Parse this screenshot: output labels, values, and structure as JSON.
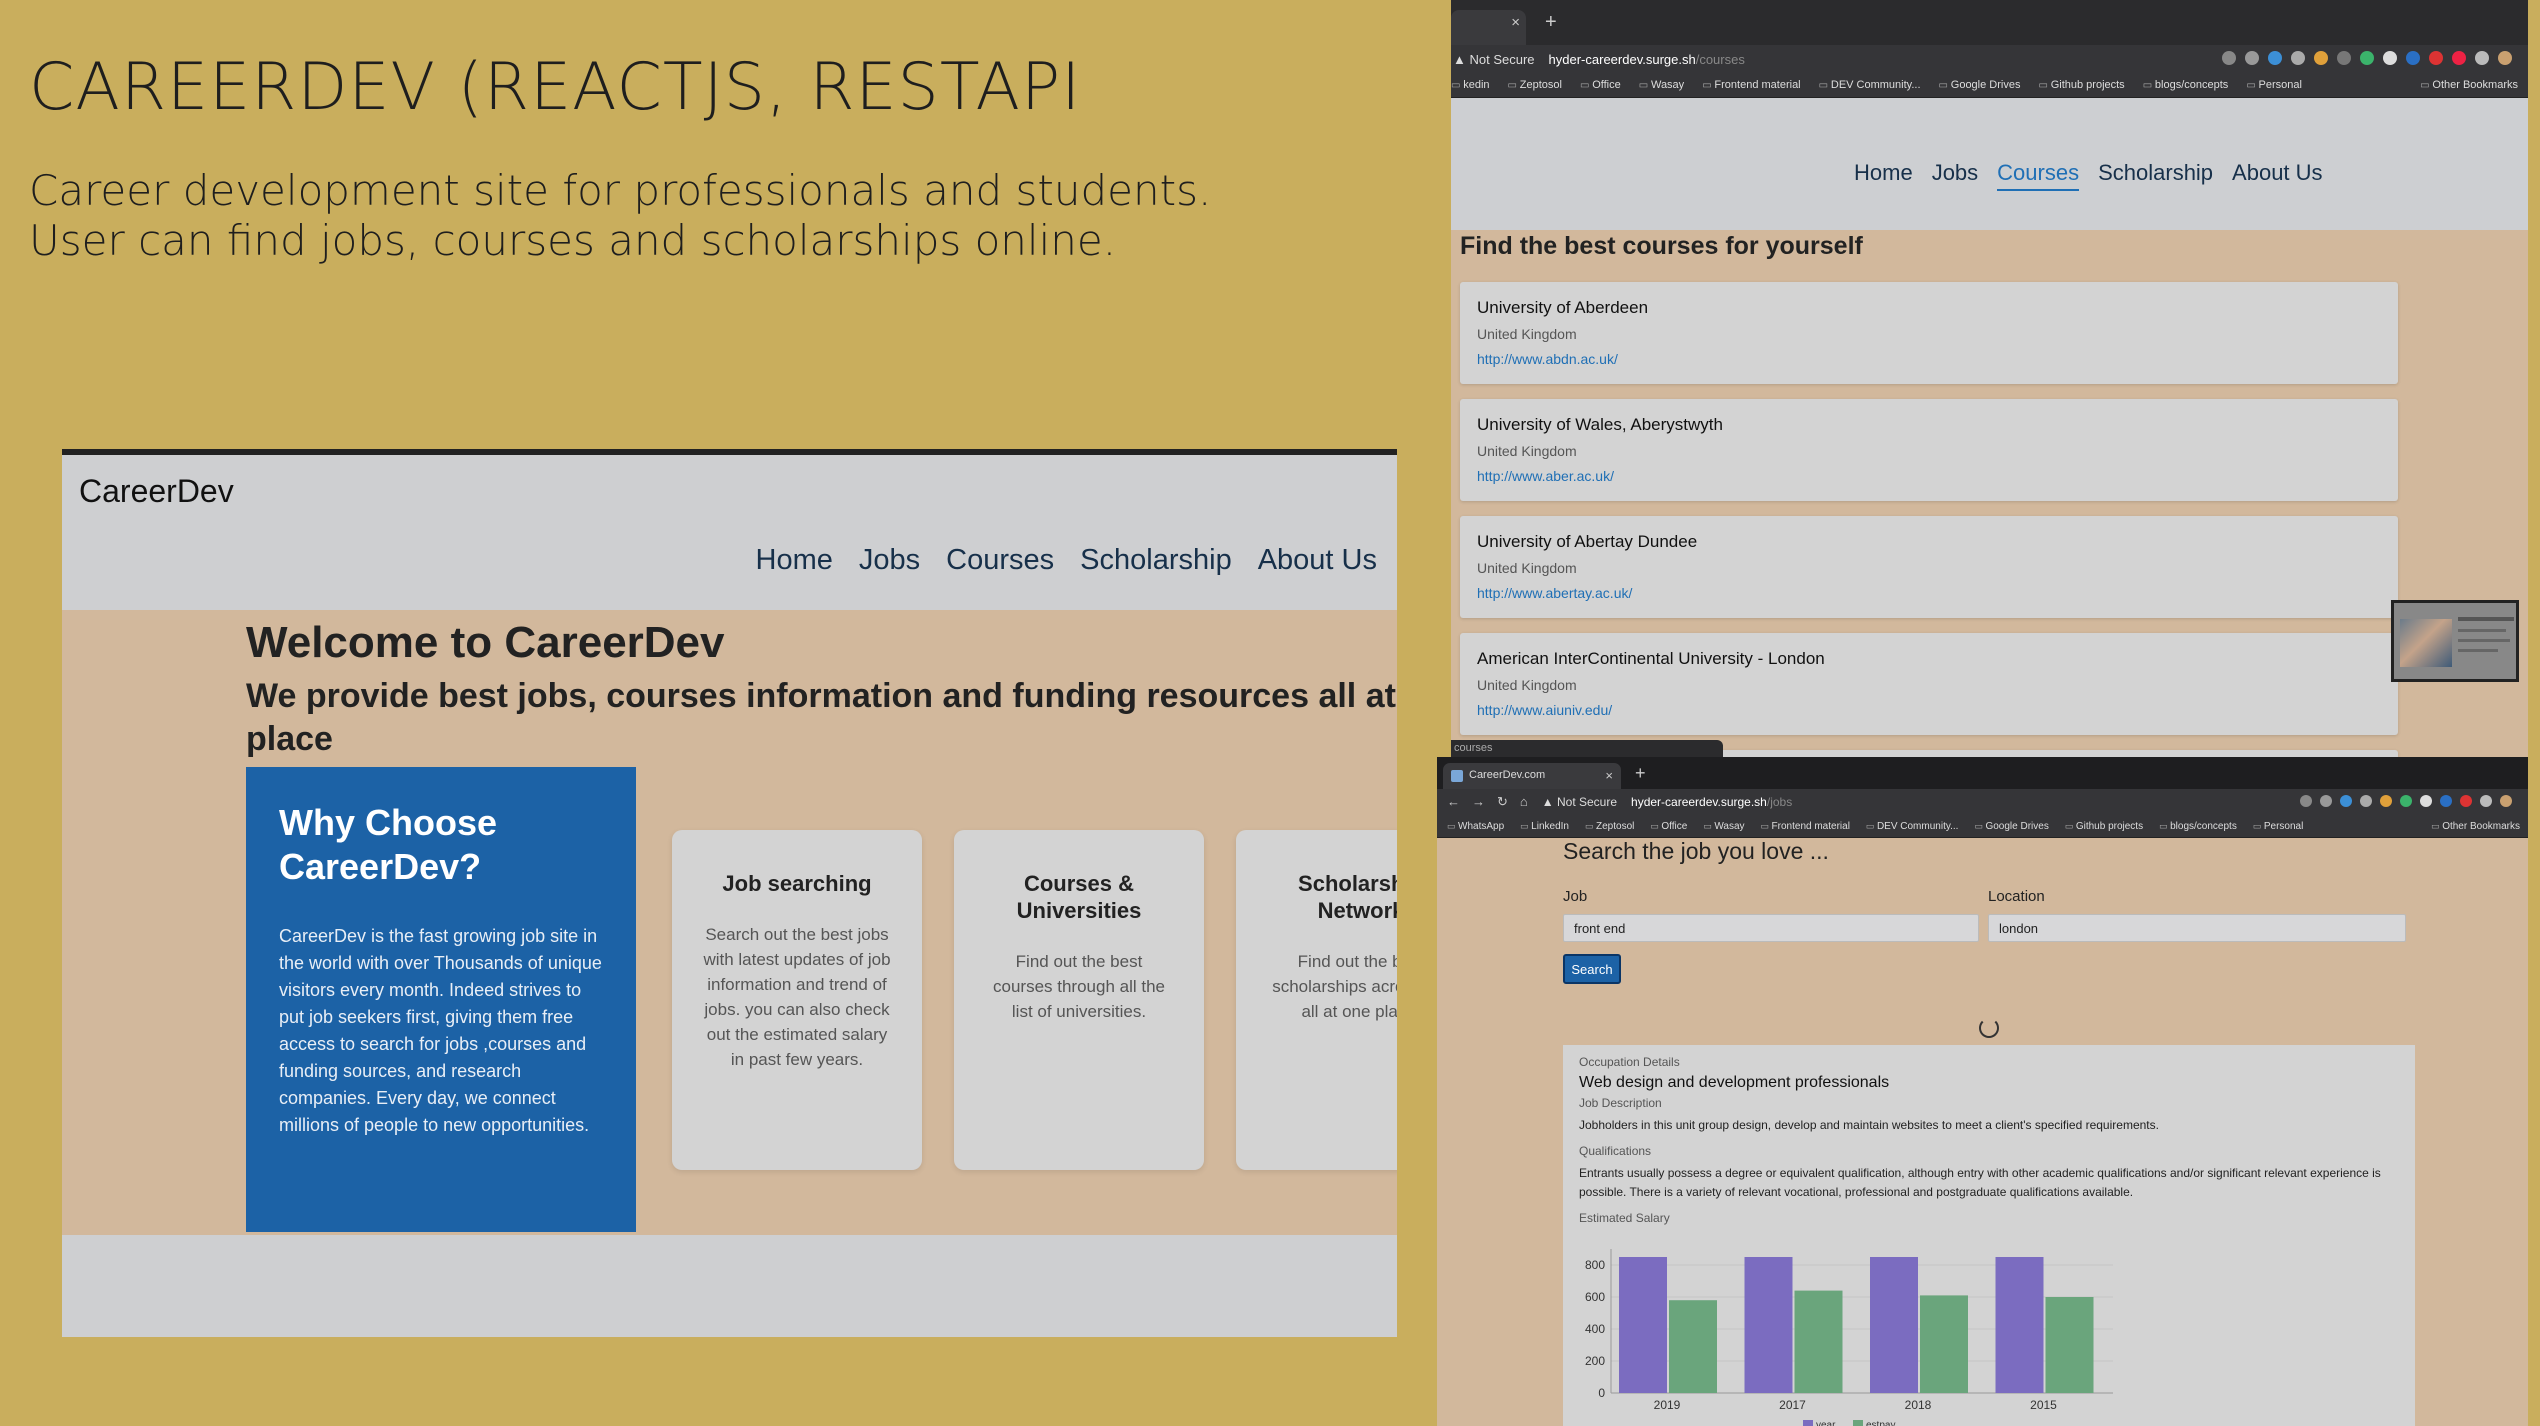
{
  "slide": {
    "title": "CAREERDEV (REACTJS, RESTAPI",
    "description_line1": "Career development site for professionals and students.",
    "description_line2": "User can find jobs, courses and scholarships online."
  },
  "landing": {
    "brand": "CareerDev",
    "nav": [
      "Home",
      "Jobs",
      "Courses",
      "Scholarship",
      "About Us"
    ],
    "welcome": "Welcome to CareerDev",
    "tagline": "We provide best jobs, courses information and funding resources all at one place",
    "why": {
      "title": "Why Choose CareerDev?",
      "text": "CareerDev is the fast growing job site in the world with over Thousands of unique visitors every month. Indeed strives to put job seekers first, giving them free access to search for jobs ,courses and funding sources, and research companies. Every day, we connect millions of people to new opportunities."
    },
    "cards": [
      {
        "title": "Job searching",
        "text": "Search out the best jobs with latest updates of job information and trend of jobs. you can also check out the estimated salary in past few years."
      },
      {
        "title": "Courses & Universities",
        "text": "Find out the best courses through all the list of universities."
      },
      {
        "title": "Scholarship Network",
        "text": "Find out the best scholarships across UK all at one place."
      }
    ]
  },
  "browser1": {
    "address": {
      "not_secure": "Not Secure",
      "host": "hyder-careerdev.surge.sh",
      "path": "/courses"
    },
    "bookmarks": [
      "kedin",
      "Zeptosol",
      "Office",
      "Wasay",
      "Frontend material",
      "DEV Community...",
      "Google Drives",
      "Github projects",
      "blogs/concepts",
      "Personal"
    ],
    "other_bookmarks": "Other Bookmarks",
    "nav": [
      "Home",
      "Jobs",
      "Courses",
      "Scholarship",
      "About Us"
    ],
    "active_nav": "Courses",
    "heading": "Find the best courses for yourself",
    "universities": [
      {
        "name": "University of Aberdeen",
        "country": "United Kingdom",
        "url": "http://www.abdn.ac.uk/"
      },
      {
        "name": "University of Wales, Aberystwyth",
        "country": "United Kingdom",
        "url": "http://www.aber.ac.uk/"
      },
      {
        "name": "University of Abertay Dundee",
        "country": "United Kingdom",
        "url": "http://www.abertay.ac.uk/"
      },
      {
        "name": "American InterContinental University - London",
        "country": "United Kingdom",
        "url": "http://www.aiuniv.edu/"
      }
    ],
    "status": "courses"
  },
  "browser2": {
    "tab_title": "CareerDev.com",
    "address": {
      "not_secure": "Not Secure",
      "host": "hyder-careerdev.surge.sh",
      "path": "/jobs"
    },
    "bookmarks": [
      "WhatsApp",
      "LinkedIn",
      "Zeptosol",
      "Office",
      "Wasay",
      "Frontend material",
      "DEV Community...",
      "Google Drives",
      "Github projects",
      "blogs/concepts",
      "Personal"
    ],
    "other_bookmarks": "Other Bookmarks",
    "heading": "Search the job you love ...",
    "job_label": "Job",
    "job_value": "front end",
    "location_label": "Location",
    "location_value": "london",
    "search_button": "Search",
    "occupation": {
      "section": "Occupation Details",
      "title": "Web design and development professionals",
      "desc_label": "Job Description",
      "desc": "Jobholders in this unit group design, develop and maintain websites to meet a client's specified requirements.",
      "qual_label": "Qualifications",
      "qual": "Entrants usually possess a degree or equivalent qualification, although entry with other academic qualifications and/or significant relevant experience is possible. There is a variety of relevant vocational, professional and postgraduate qualifications available.",
      "salary_label": "Estimated Salary"
    }
  },
  "colors": {
    "bar_primary": "#7b6cc0",
    "bar_secondary": "#6aa57c",
    "accent": "#1c62a6"
  },
  "chart_data": {
    "type": "bar",
    "categories": [
      "2019",
      "2017",
      "2018",
      "2015"
    ],
    "series": [
      {
        "name": "year",
        "values": [
          850,
          850,
          850,
          850
        ]
      },
      {
        "name": "estpay",
        "values": [
          580,
          640,
          610,
          600
        ]
      }
    ],
    "yticks": [
      0,
      200,
      400,
      600,
      800
    ],
    "ylim": [
      0,
      900
    ]
  }
}
